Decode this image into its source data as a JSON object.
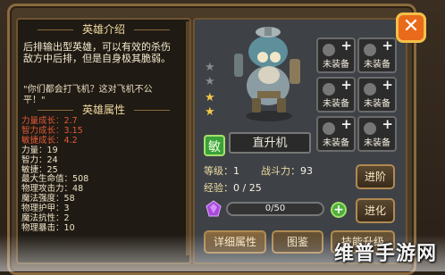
{
  "left_panel": {
    "intro_title": "英雄介绍",
    "intro_text": "后排输出型英雄，可以有效的杀伤敌方中后排，但是自身极其脆弱。",
    "quote": "\"你们都会打飞机？这对飞机不公平！\"",
    "attr_title": "英雄属性",
    "growth": [
      {
        "label": "力量成长",
        "value": "2.7"
      },
      {
        "label": "智力成长",
        "value": "3.15"
      },
      {
        "label": "敏捷成长",
        "value": "4.2"
      }
    ],
    "attrs": [
      {
        "label": "力量",
        "value": "19"
      },
      {
        "label": "智力",
        "value": "24"
      },
      {
        "label": "敏捷",
        "value": "25"
      },
      {
        "label": "最大生命值",
        "value": "508"
      },
      {
        "label": "物理攻击力",
        "value": "48"
      },
      {
        "label": "魔法强度",
        "value": "58"
      },
      {
        "label": "物理护甲",
        "value": "3"
      },
      {
        "label": "魔法抗性",
        "value": "2"
      },
      {
        "label": "物理暴击",
        "value": "10"
      }
    ]
  },
  "hero": {
    "name": "直升机",
    "type_badge": "敏",
    "level_label": "等级",
    "level_value": "1",
    "power_label": "战斗力",
    "power_value": "93",
    "exp_label": "经验",
    "exp_value": "0 / 25",
    "stars_filled": 2,
    "stars_total": 4
  },
  "equipment_slot_label": "未装备",
  "soulstone": {
    "current": 0,
    "max": 50,
    "text": "0/50"
  },
  "buttons": {
    "advance": "进阶",
    "evolve": "进化"
  },
  "tabs": [
    "详细属性",
    "图鉴",
    "技能升级"
  ],
  "watermark": "维普手游网",
  "colors": {
    "growth_red": "#e05a3a",
    "close_orange": "#e86a1a",
    "type_green": "#3aa23a"
  }
}
